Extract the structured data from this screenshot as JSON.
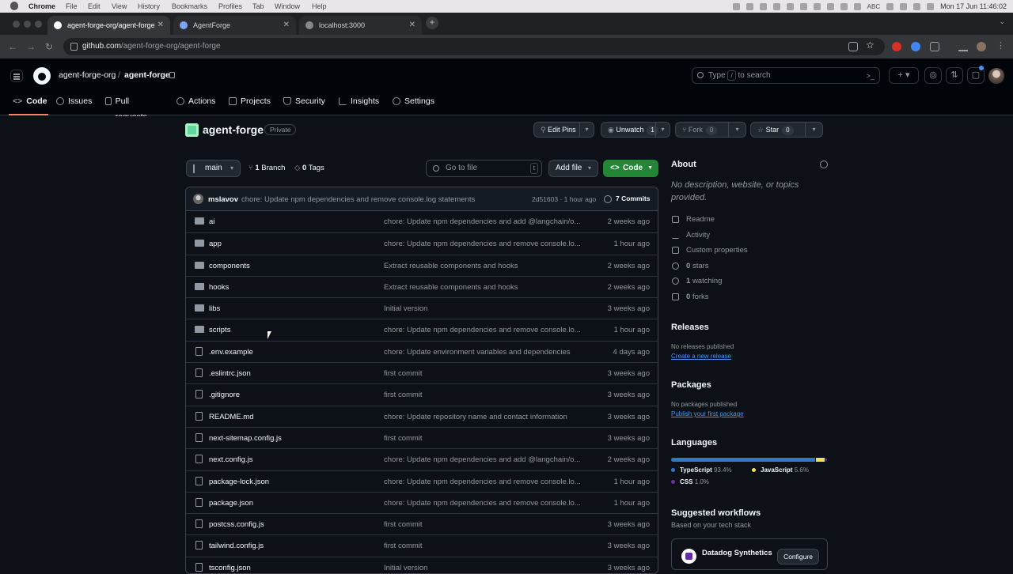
{
  "menubar": {
    "app": "Chrome",
    "items": [
      "File",
      "Edit",
      "View",
      "History",
      "Bookmarks",
      "Profiles",
      "Tab",
      "Window",
      "Help"
    ],
    "input_source": "ABC",
    "clock": "Mon 17 Jun  11:46:02"
  },
  "tabs": [
    {
      "title": "agent-forge-org/agent-forge",
      "close": "✕"
    },
    {
      "title": "AgentForge",
      "close": "✕"
    },
    {
      "title": "localhost:3000",
      "close": "✕"
    }
  ],
  "new_tab": "+",
  "omnibox": {
    "host": "github.com",
    "path": "/agent-forge-org/agent-forge"
  },
  "header": {
    "owner": "agent-forge-org",
    "separator": "/",
    "repo": "agent-forge",
    "search_before": "Type",
    "search_key": "/",
    "search_after": "to search"
  },
  "repo_nav": [
    {
      "label": "Code",
      "icon": "code-icon"
    },
    {
      "label": "Issues",
      "icon": "issue-icon"
    },
    {
      "label": "Pull requests",
      "icon": "pull-request-icon"
    },
    {
      "label": "Actions",
      "icon": "play-icon"
    },
    {
      "label": "Projects",
      "icon": "table-icon"
    },
    {
      "label": "Security",
      "icon": "shield-icon"
    },
    {
      "label": "Insights",
      "icon": "graph-icon"
    },
    {
      "label": "Settings",
      "icon": "gear-icon"
    }
  ],
  "repo": {
    "name": "agent-forge",
    "visibility": "Private",
    "edit_pins": "Edit Pins",
    "unwatch": "Unwatch",
    "watch_count": "1",
    "fork": "Fork",
    "fork_count": "0",
    "star": "Star",
    "star_count": "0"
  },
  "branch": {
    "name": "main",
    "branch_count": "1",
    "branch_label": "Branch",
    "tag_count": "0",
    "tag_label": "Tags",
    "goto_placeholder": "Go to file",
    "goto_key": "t",
    "add_file": "Add file",
    "code": "Code"
  },
  "commit": {
    "author": "mslavov",
    "message": "chore: Update npm dependencies and remove console.log statements",
    "hash_age": "2d51603 · 1 hour ago",
    "commits": "7 Commits"
  },
  "files": [
    {
      "name": "ai",
      "type": "dir",
      "msg": "chore: Update npm dependencies and add @langchain/o...",
      "age": "2 weeks ago"
    },
    {
      "name": "app",
      "type": "dir",
      "msg": "chore: Update npm dependencies and remove console.lo...",
      "age": "1 hour ago"
    },
    {
      "name": "components",
      "type": "dir",
      "msg": "Extract reusable components and hooks",
      "age": "2 weeks ago"
    },
    {
      "name": "hooks",
      "type": "dir",
      "msg": "Extract reusable components and hooks",
      "age": "2 weeks ago"
    },
    {
      "name": "libs",
      "type": "dir",
      "msg": "Initial version",
      "age": "3 weeks ago"
    },
    {
      "name": "scripts",
      "type": "dir",
      "msg": "chore: Update npm dependencies and remove console.lo...",
      "age": "1 hour ago"
    },
    {
      "name": ".env.example",
      "type": "file",
      "msg": "chore: Update environment variables and dependencies",
      "age": "4 days ago"
    },
    {
      "name": ".eslintrc.json",
      "type": "file",
      "msg": "first commit",
      "age": "3 weeks ago"
    },
    {
      "name": ".gitignore",
      "type": "file",
      "msg": "first commit",
      "age": "3 weeks ago"
    },
    {
      "name": "README.md",
      "type": "file",
      "msg": "chore: Update repository name and contact information",
      "age": "3 weeks ago"
    },
    {
      "name": "next-sitemap.config.js",
      "type": "file",
      "msg": "first commit",
      "age": "3 weeks ago"
    },
    {
      "name": "next.config.js",
      "type": "file",
      "msg": "chore: Update npm dependencies and add @langchain/o...",
      "age": "2 weeks ago"
    },
    {
      "name": "package-lock.json",
      "type": "file",
      "msg": "chore: Update npm dependencies and remove console.lo...",
      "age": "1 hour ago"
    },
    {
      "name": "package.json",
      "type": "file",
      "msg": "chore: Update npm dependencies and remove console.lo...",
      "age": "1 hour ago"
    },
    {
      "name": "postcss.config.js",
      "type": "file",
      "msg": "first commit",
      "age": "3 weeks ago"
    },
    {
      "name": "tailwind.config.js",
      "type": "file",
      "msg": "first commit",
      "age": "3 weeks ago"
    },
    {
      "name": "tsconfig.json",
      "type": "file",
      "msg": "Initial version",
      "age": "3 weeks ago"
    }
  ],
  "about": {
    "title": "About",
    "description": "No description, website, or topics provided.",
    "links": [
      {
        "label": "Readme",
        "icon": "book-icon"
      },
      {
        "label": "Activity",
        "icon": "pulse-icon"
      },
      {
        "label": "Custom properties",
        "icon": "note-icon"
      },
      {
        "count": "0",
        "label": "stars",
        "icon": "star-icon"
      },
      {
        "count": "1",
        "label": "watching",
        "icon": "eye-icon"
      },
      {
        "count": "0",
        "label": "forks",
        "icon": "fork-icon"
      }
    ]
  },
  "releases": {
    "title": "Releases",
    "text": "No releases published",
    "link": "Create a new release"
  },
  "packages": {
    "title": "Packages",
    "text": "No packages published",
    "link": "Publish your first package"
  },
  "languages": {
    "title": "Languages",
    "items": [
      {
        "name": "TypeScript",
        "pct": "93.4%",
        "value": 93.4,
        "color": "#3178c6"
      },
      {
        "name": "JavaScript",
        "pct": "5.6%",
        "value": 5.6,
        "color": "#f1e05a"
      },
      {
        "name": "CSS",
        "pct": "1.0%",
        "value": 1.0,
        "color": "#663399"
      }
    ]
  },
  "workflows": {
    "title": "Suggested workflows",
    "subtitle": "Based on your tech stack",
    "card_name": "Datadog Synthetics",
    "card_button": "Configure"
  }
}
